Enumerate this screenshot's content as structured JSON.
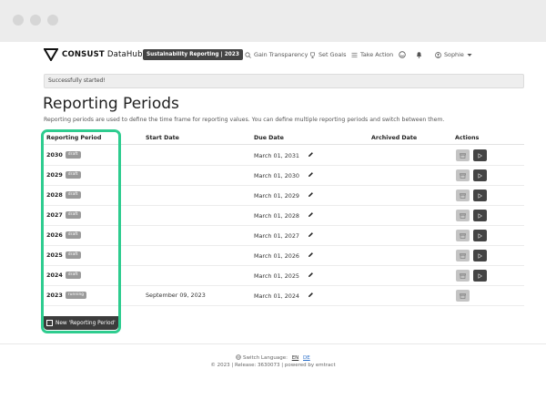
{
  "app": {
    "logo_text_bold": "CONSUST",
    "logo_text_light": " DataHub",
    "project_badge": "Sustainability Reporting | 2023"
  },
  "nav": {
    "gain_transparency": "Gain Transparency",
    "set_goals": "Set Goals",
    "take_action": "Take Action",
    "user": "Sophie"
  },
  "alert": {
    "text": "Successfully started!"
  },
  "page": {
    "title": "Reporting Periods",
    "description": "Reporting periods are used to define the time frame for reporting values. You can define multiple reporting periods and switch between them."
  },
  "table": {
    "headers": {
      "period": "Reporting Period",
      "start": "Start Date",
      "due": "Due Date",
      "archived": "Archived Date",
      "actions": "Actions"
    },
    "rows": [
      {
        "year": "2030",
        "status": "draft",
        "start": "",
        "due": "March 01, 2031",
        "archived": "",
        "can_run": true
      },
      {
        "year": "2029",
        "status": "draft",
        "start": "",
        "due": "March 01, 2030",
        "archived": "",
        "can_run": true
      },
      {
        "year": "2028",
        "status": "draft",
        "start": "",
        "due": "March 01, 2029",
        "archived": "",
        "can_run": true
      },
      {
        "year": "2027",
        "status": "draft",
        "start": "",
        "due": "March 01, 2028",
        "archived": "",
        "can_run": true
      },
      {
        "year": "2026",
        "status": "draft",
        "start": "",
        "due": "March 01, 2027",
        "archived": "",
        "can_run": true
      },
      {
        "year": "2025",
        "status": "draft",
        "start": "",
        "due": "March 01, 2026",
        "archived": "",
        "can_run": true
      },
      {
        "year": "2024",
        "status": "draft",
        "start": "",
        "due": "March 01, 2025",
        "archived": "",
        "can_run": true
      },
      {
        "year": "2023",
        "status": "running",
        "start": "September 09, 2023",
        "due": "March 01, 2024",
        "archived": "",
        "can_run": false
      }
    ],
    "new_button": "New 'Reporting Period'"
  },
  "footer": {
    "switch_language": "Switch Language:",
    "lang_en": "EN",
    "lang_de": "DE",
    "release": "© 2023 | Release: 3630073 | powered by emtract"
  },
  "colors": {
    "highlight": "#2ecc8f",
    "badge_bg": "#9a9a9a",
    "run_button": "#444444",
    "archive_button": "#c4c4c4"
  },
  "icons": {
    "logo": "consust-logo-icon",
    "gain_transparency": "search-icon",
    "set_goals": "trophy-icon",
    "take_action": "list-icon",
    "emoji": "smiley-icon",
    "notifications": "bell-icon",
    "user": "user-icon",
    "edit": "pencil-icon",
    "archive": "archive-box-icon",
    "run": "play-icon",
    "language": "globe-icon"
  }
}
